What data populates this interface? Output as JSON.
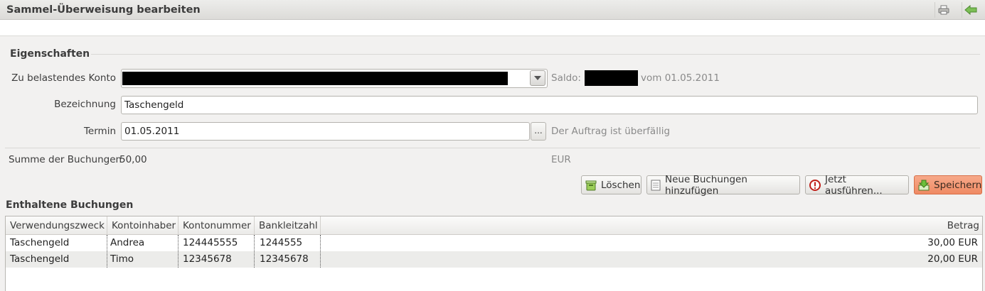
{
  "window": {
    "title": "Sammel-Überweisung bearbeiten",
    "icons": [
      "printer-icon",
      "back-arrow-icon"
    ]
  },
  "eigenschaften": {
    "section_title": "Eigenschaften",
    "konto_label": "Zu belastendes Konto",
    "saldo_label": "Saldo:",
    "saldo_date": "vom 01.05.2011",
    "bezeichnung_label": "Bezeichnung",
    "bezeichnung_value": "Taschengeld",
    "termin_label": "Termin",
    "termin_value": "01.05.2011",
    "termin_button": "...",
    "termin_status": "Der Auftrag ist überfällig",
    "summe_label": "Summe der Buchungen",
    "summe_value": "50,00",
    "summe_currency": "EUR"
  },
  "actions": {
    "delete": "Löschen",
    "add": "Neue Buchungen hinzufügen",
    "execute": "Jetzt ausführen...",
    "save": "Speichern"
  },
  "buchungen": {
    "section_title": "Enthaltene Buchungen",
    "columns": [
      "Verwendungszweck",
      "Kontoinhaber",
      "Kontonummer",
      "Bankleitzahl",
      "Betrag"
    ],
    "rows": [
      [
        "Taschengeld",
        "Andrea",
        "124445555",
        "1244555",
        "30,00 EUR"
      ],
      [
        "Taschengeld",
        "Timo",
        "12345678",
        "12345678",
        "20,00 EUR"
      ]
    ]
  },
  "colors": {
    "accent_save": "#ef8a63",
    "background": "#f2f1f0",
    "back_arrow": "#6ab04c",
    "overdue_text": "#8a8a8a"
  }
}
